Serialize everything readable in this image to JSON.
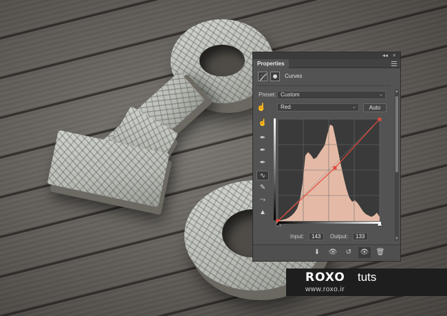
{
  "panel": {
    "title": "Properties",
    "window_controls": {
      "collapse": "◂◂",
      "close": "×"
    },
    "adjustment": "Curves",
    "preset": {
      "label": "Preset:",
      "value": "Custom"
    },
    "channel": {
      "value": "Red"
    },
    "auto_label": "Auto",
    "input": {
      "label": "Input:",
      "value": "143"
    },
    "output": {
      "label": "Output:",
      "value": "133"
    }
  },
  "tools": [
    {
      "name": "on-image-adjust-icon",
      "glyph": "☝"
    },
    {
      "name": "black-point-eyedropper-icon",
      "glyph": "✒"
    },
    {
      "name": "gray-point-eyedropper-icon",
      "glyph": "✒"
    },
    {
      "name": "white-point-eyedropper-icon",
      "glyph": "✒"
    },
    {
      "name": "curve-points-icon",
      "glyph": "∿"
    },
    {
      "name": "pencil-icon",
      "glyph": "✎"
    },
    {
      "name": "smooth-icon",
      "glyph": "⤳"
    },
    {
      "name": "clipping-warning-icon",
      "glyph": "▲"
    }
  ],
  "bottom_buttons": [
    {
      "name": "clip-to-layer-icon",
      "glyph": "⬇"
    },
    {
      "name": "view-previous-icon",
      "glyph": "👁"
    },
    {
      "name": "reset-icon",
      "glyph": "↺"
    },
    {
      "name": "visibility-icon",
      "glyph": "👁"
    },
    {
      "name": "delete-icon",
      "glyph": "🗑"
    }
  ],
  "curve": {
    "channel_color": "#e24a3c",
    "histogram_color": "#f3c6b0",
    "points": [
      [
        0,
        0
      ],
      [
        143,
        133
      ],
      [
        255,
        255
      ]
    ]
  },
  "watermark": {
    "logo": "ROXO",
    "tag": "tuts",
    "url": "www.roxo.ir"
  }
}
